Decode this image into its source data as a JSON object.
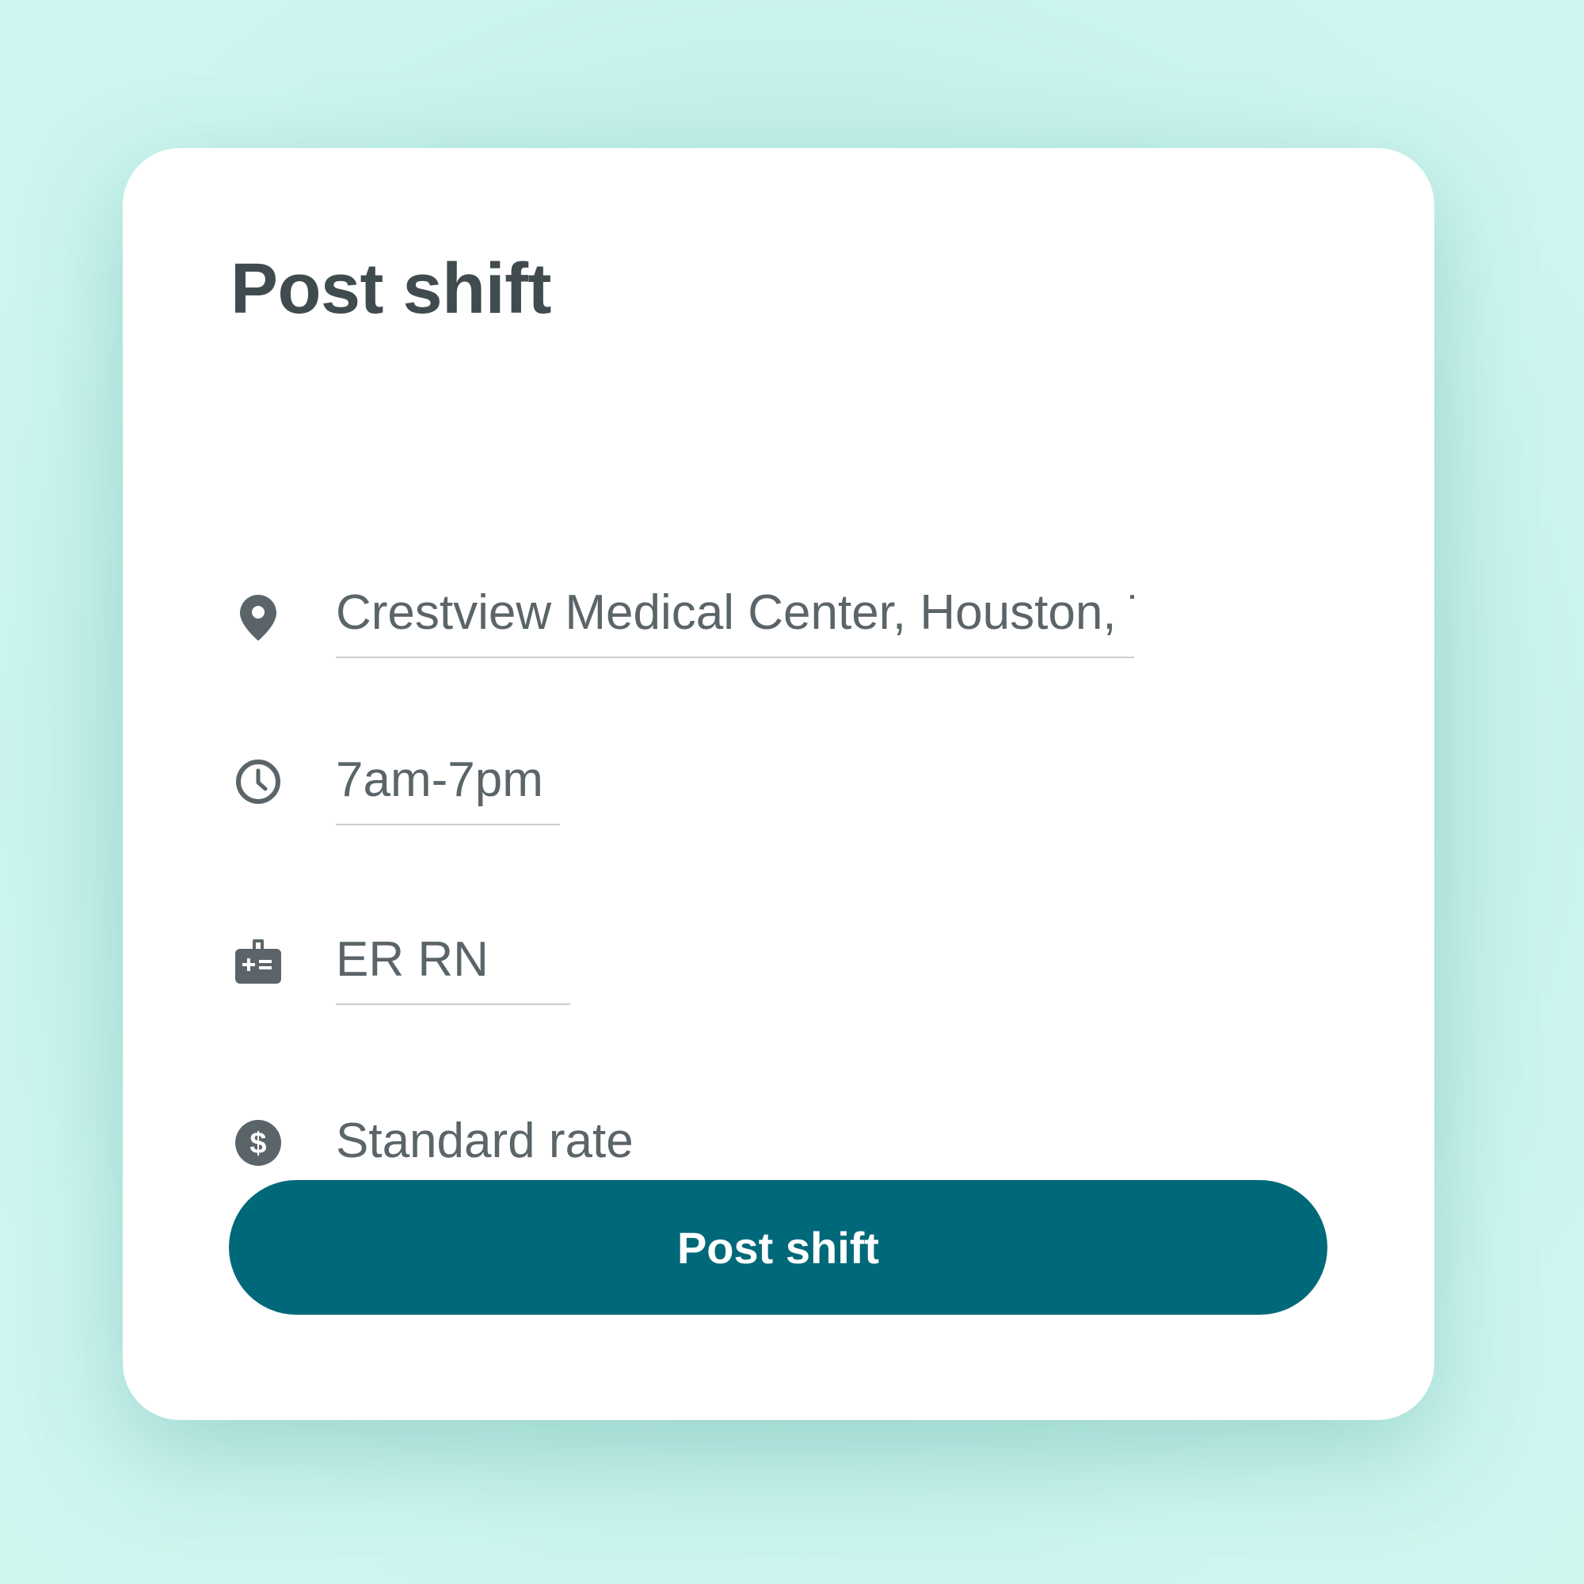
{
  "card": {
    "title": "Post shift"
  },
  "fields": {
    "location": {
      "icon": "location-pin-icon",
      "value": "Crestview Medical Center, Houston, TX"
    },
    "time": {
      "icon": "clock-icon",
      "value": "7am-7pm"
    },
    "role": {
      "icon": "medical-badge-icon",
      "value": "ER RN"
    },
    "rate": {
      "icon": "dollar-coin-icon",
      "value": "Standard rate"
    }
  },
  "actions": {
    "post_label": "Post shift"
  },
  "colors": {
    "background": "#bdece5",
    "card": "#ffffff",
    "title_text": "#404b4f",
    "field_text": "#5b6569",
    "icon": "#5b6569",
    "underline": "#c8cdd0",
    "button": "#006979",
    "button_text": "#ffffff"
  }
}
